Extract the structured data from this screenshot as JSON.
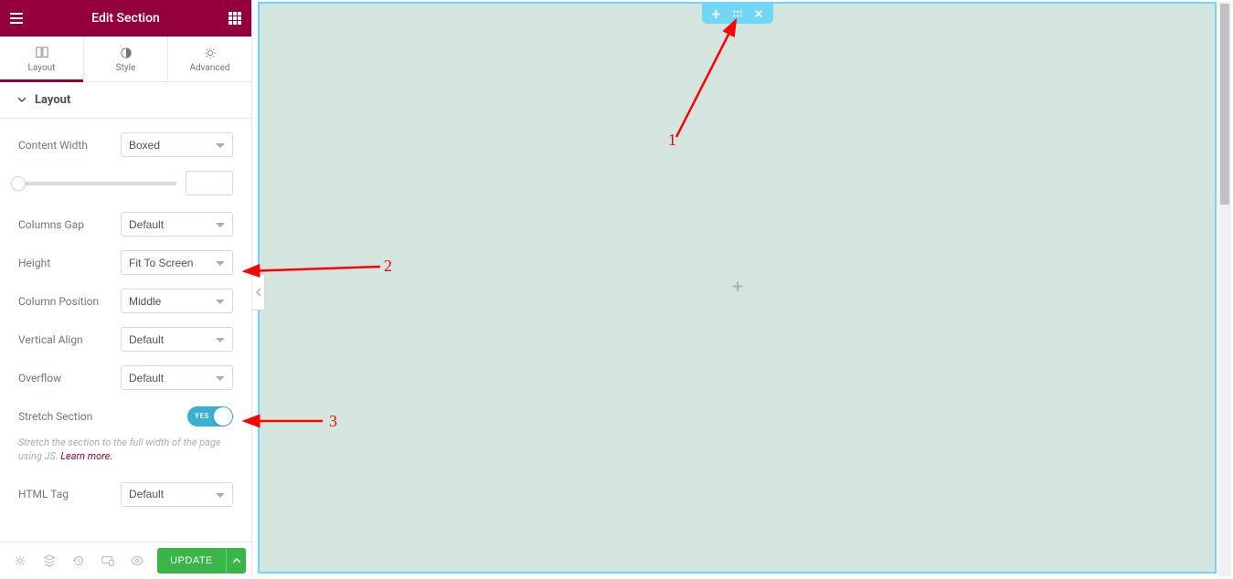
{
  "header": {
    "title": "Edit Section"
  },
  "tabs": {
    "layout": "Layout",
    "style": "Style",
    "advanced": "Advanced"
  },
  "section_title": "Layout",
  "controls": {
    "content_width": {
      "label": "Content Width",
      "value": "Boxed"
    },
    "columns_gap": {
      "label": "Columns Gap",
      "value": "Default"
    },
    "height": {
      "label": "Height",
      "value": "Fit To Screen"
    },
    "column_position": {
      "label": "Column Position",
      "value": "Middle"
    },
    "vertical_align": {
      "label": "Vertical Align",
      "value": "Default"
    },
    "overflow": {
      "label": "Overflow",
      "value": "Default"
    },
    "stretch_section": {
      "label": "Stretch Section",
      "toggle_text": "YES"
    },
    "stretch_desc_pre": "Stretch the section to the full width of the page using JS. ",
    "stretch_desc_link": "Learn more.",
    "html_tag": {
      "label": "HTML Tag",
      "value": "Default"
    }
  },
  "footer": {
    "update": "UPDATE"
  },
  "annotations": {
    "one": "1",
    "two": "2",
    "three": "3"
  }
}
